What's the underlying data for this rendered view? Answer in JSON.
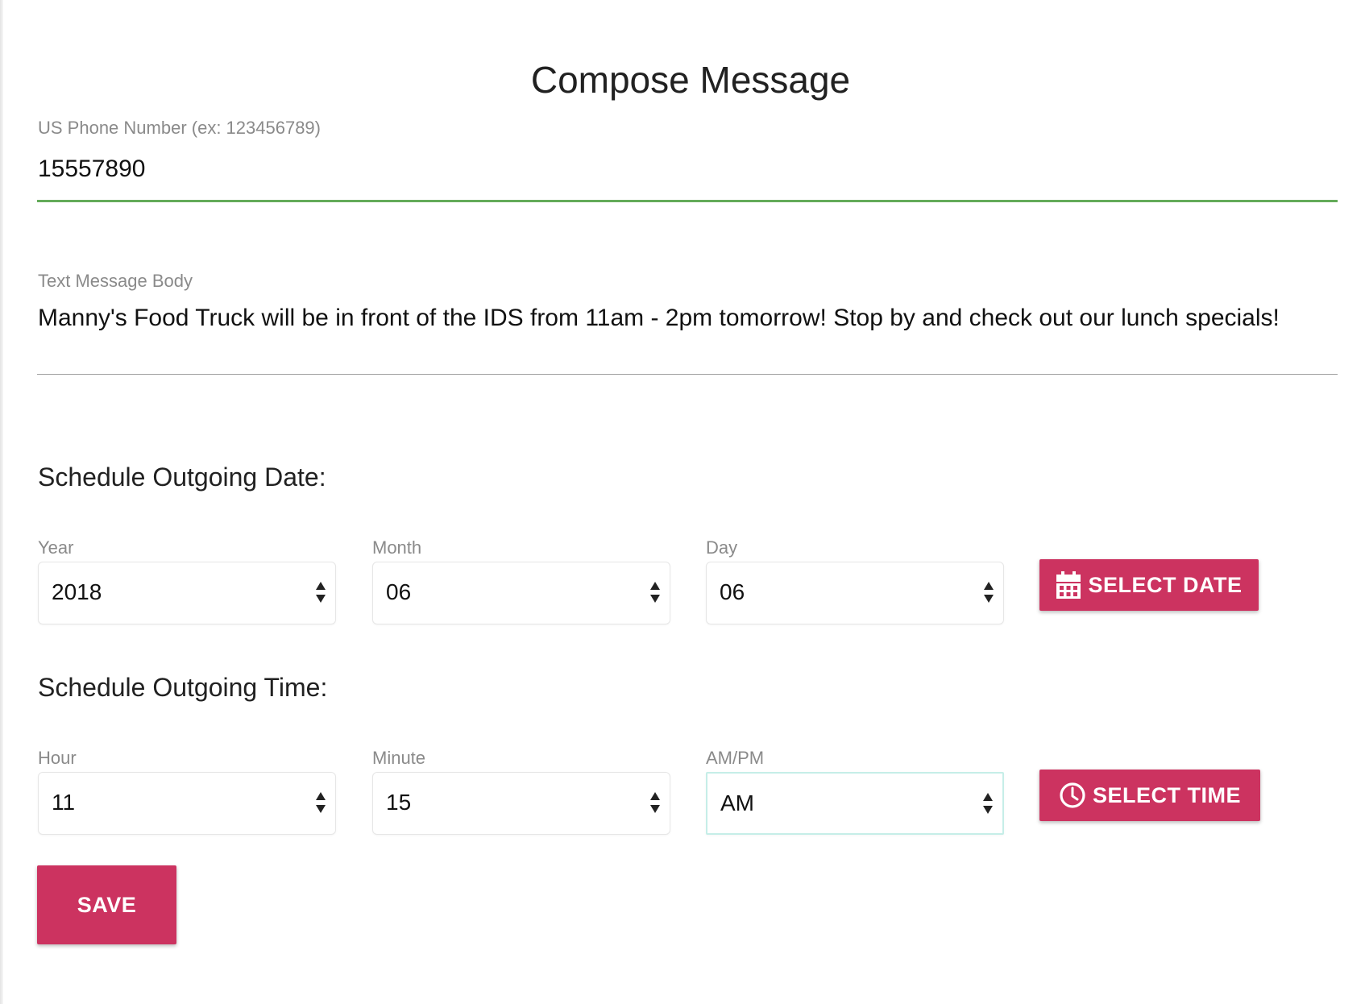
{
  "page": {
    "title": "Compose Message"
  },
  "phone": {
    "label": "US Phone Number (ex: 123456789)",
    "value": "15557890"
  },
  "message": {
    "label": "Text Message Body",
    "value": "Manny's Food Truck will be in front of the IDS from 11am - 2pm tomorrow! Stop by and check out our lunch specials!"
  },
  "date_section": {
    "heading": "Schedule Outgoing Date:",
    "year": {
      "label": "Year",
      "value": "2018"
    },
    "month": {
      "label": "Month",
      "value": "06"
    },
    "day": {
      "label": "Day",
      "value": "06"
    },
    "button": {
      "label": "SELECT DATE",
      "icon": "calendar-icon"
    }
  },
  "time_section": {
    "heading": "Schedule Outgoing Time:",
    "hour": {
      "label": "Hour",
      "value": "11"
    },
    "minute": {
      "label": "Minute",
      "value": "15"
    },
    "ampm": {
      "label": "AM/PM",
      "value": "AM"
    },
    "button": {
      "label": "SELECT TIME",
      "icon": "clock-icon"
    }
  },
  "save": {
    "label": "SAVE"
  },
  "colors": {
    "accent": "#cc3360",
    "active_underline": "#64ab5a",
    "label_gray": "#8a8a8a",
    "focus_border": "#c6eee8"
  }
}
